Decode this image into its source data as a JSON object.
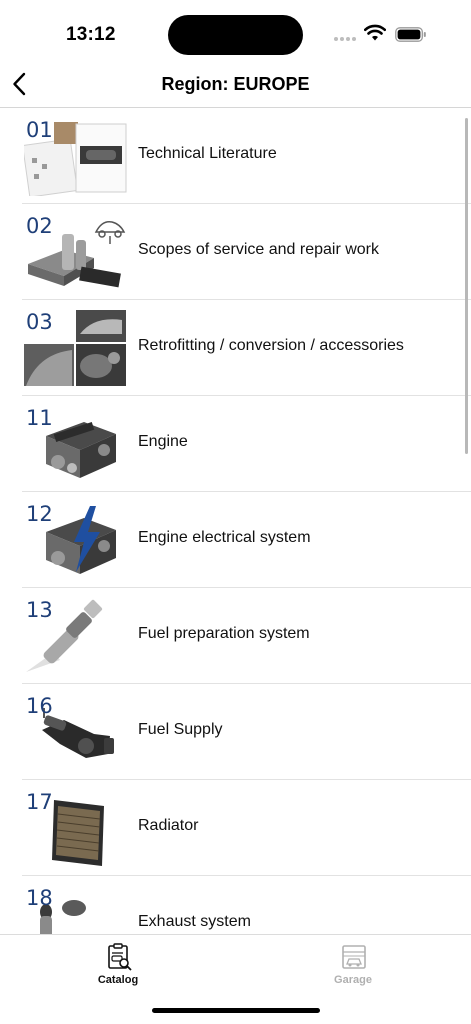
{
  "status_bar": {
    "time": "13:12"
  },
  "nav": {
    "title": "Region: EUROPE"
  },
  "list": {
    "items": [
      {
        "number": "01",
        "label": "Technical Literature",
        "icon": "technical-literature-thumb"
      },
      {
        "number": "02",
        "label": "Scopes of service and repair work",
        "icon": "service-scope-thumb"
      },
      {
        "number": "03",
        "label": "Retrofitting / conversion / accessories",
        "icon": "retrofitting-thumb"
      },
      {
        "number": "11",
        "label": "Engine",
        "icon": "engine-thumb"
      },
      {
        "number": "12",
        "label": "Engine electrical system",
        "icon": "engine-electrical-thumb"
      },
      {
        "number": "13",
        "label": "Fuel preparation system",
        "icon": "fuel-injector-thumb"
      },
      {
        "number": "16",
        "label": "Fuel Supply",
        "icon": "fuel-supply-thumb"
      },
      {
        "number": "17",
        "label": "Radiator",
        "icon": "radiator-thumb"
      },
      {
        "number": "18",
        "label": "Exhaust system",
        "icon": "exhaust-thumb"
      }
    ]
  },
  "tab_bar": {
    "catalog_label": "Catalog",
    "garage_label": "Garage",
    "active": "Catalog"
  },
  "colors": {
    "accent_number": "#1f3f78",
    "active_tab": "#111111",
    "inactive_tab": "#b0b0b0"
  }
}
